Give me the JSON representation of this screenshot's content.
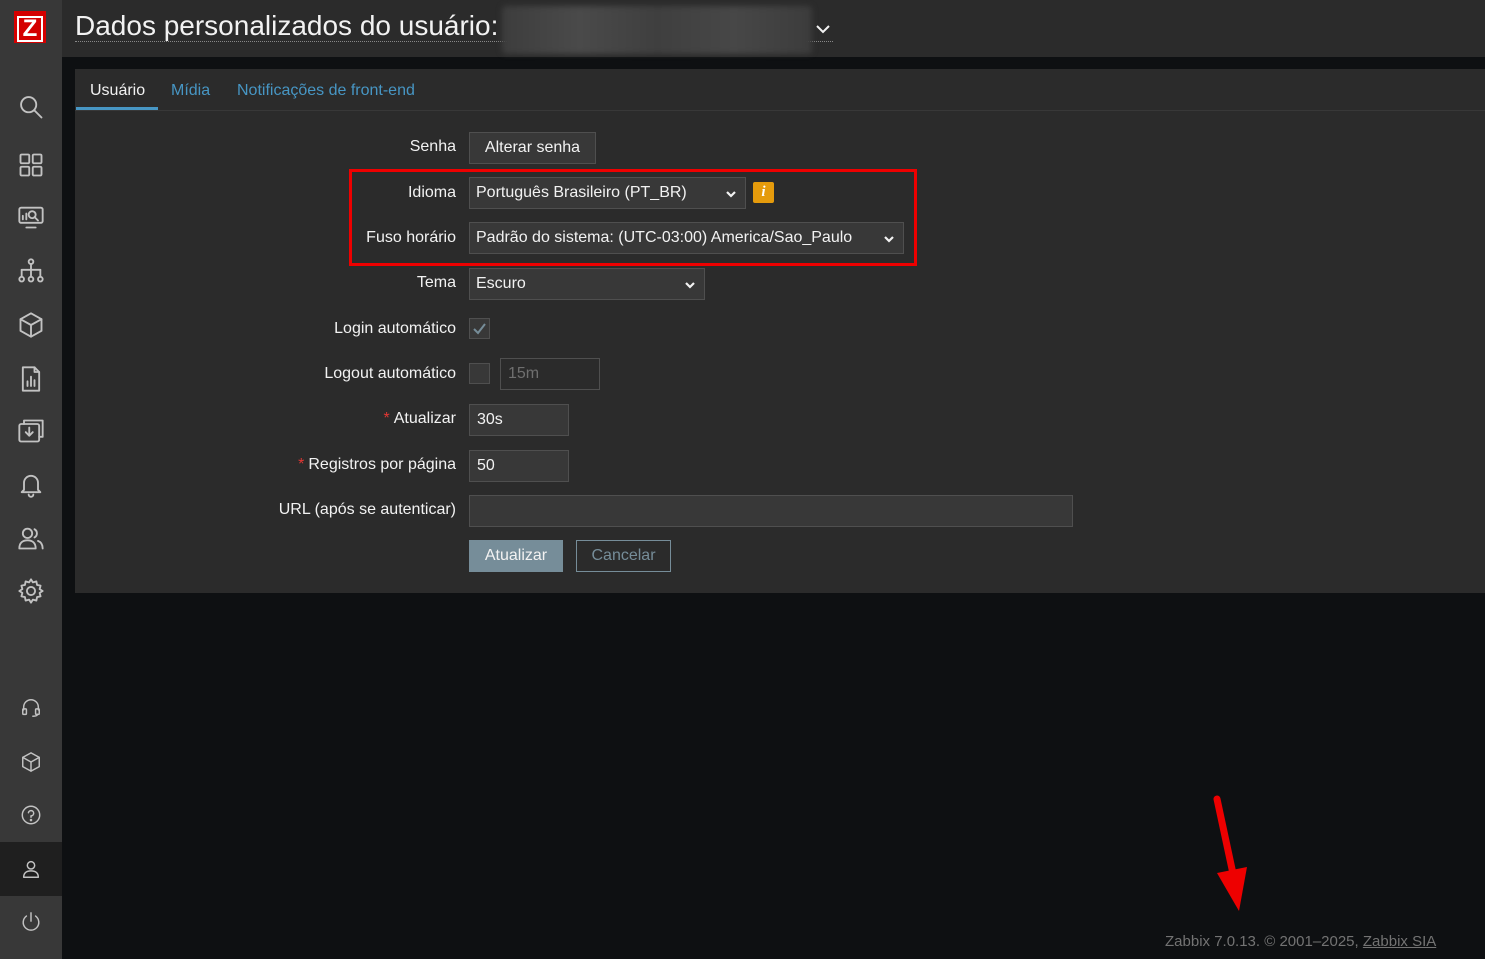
{
  "app": {
    "logo_letter": "Z",
    "brand_color": "#d40000"
  },
  "sidebar": {
    "items": [
      {
        "name": "search-icon"
      },
      {
        "name": "dashboards-icon"
      },
      {
        "name": "monitoring-icon"
      },
      {
        "name": "services-icon"
      },
      {
        "name": "inventory-icon"
      },
      {
        "name": "reports-icon"
      },
      {
        "name": "data-collection-icon"
      },
      {
        "name": "alerts-icon"
      },
      {
        "name": "users-icon"
      },
      {
        "name": "administration-icon"
      },
      {
        "name": "support-icon"
      },
      {
        "name": "integrations-icon"
      },
      {
        "name": "help-icon"
      },
      {
        "name": "user-settings-icon"
      },
      {
        "name": "sign-out-icon"
      }
    ]
  },
  "header": {
    "title": "Dados personalizados do usuário:"
  },
  "tabs": [
    {
      "label": "Usuário",
      "active": true
    },
    {
      "label": "Mídia",
      "active": false
    },
    {
      "label": "Notificações de front-end",
      "active": false
    }
  ],
  "form": {
    "password": {
      "label": "Senha",
      "button": "Alterar senha"
    },
    "language": {
      "label": "Idioma",
      "value": "Português Brasileiro (PT_BR)",
      "info": "i"
    },
    "timezone": {
      "label": "Fuso horário",
      "value": "Padrão do sistema: (UTC-03:00) America/Sao_Paulo"
    },
    "theme": {
      "label": "Tema",
      "value": "Escuro"
    },
    "autologin": {
      "label": "Login automático",
      "checked": true
    },
    "autologout": {
      "label": "Logout automático",
      "checked": false,
      "placeholder": "15m"
    },
    "refresh": {
      "label": "Atualizar",
      "required_mark": "*",
      "value": "30s"
    },
    "rows_per_page": {
      "label": "Registros por página",
      "required_mark": "*",
      "value": "50"
    },
    "url": {
      "label": "URL (após se autenticar)",
      "value": ""
    },
    "submit": "Atualizar",
    "cancel": "Cancelar"
  },
  "footer": {
    "text": "Zabbix 7.0.13. © 2001–2025,",
    "link": "Zabbix SIA"
  },
  "colors": {
    "accent": "#4796c4",
    "highlight_annotation": "#ee0000",
    "info_badge": "#e59b0c",
    "required": "#e33734"
  }
}
